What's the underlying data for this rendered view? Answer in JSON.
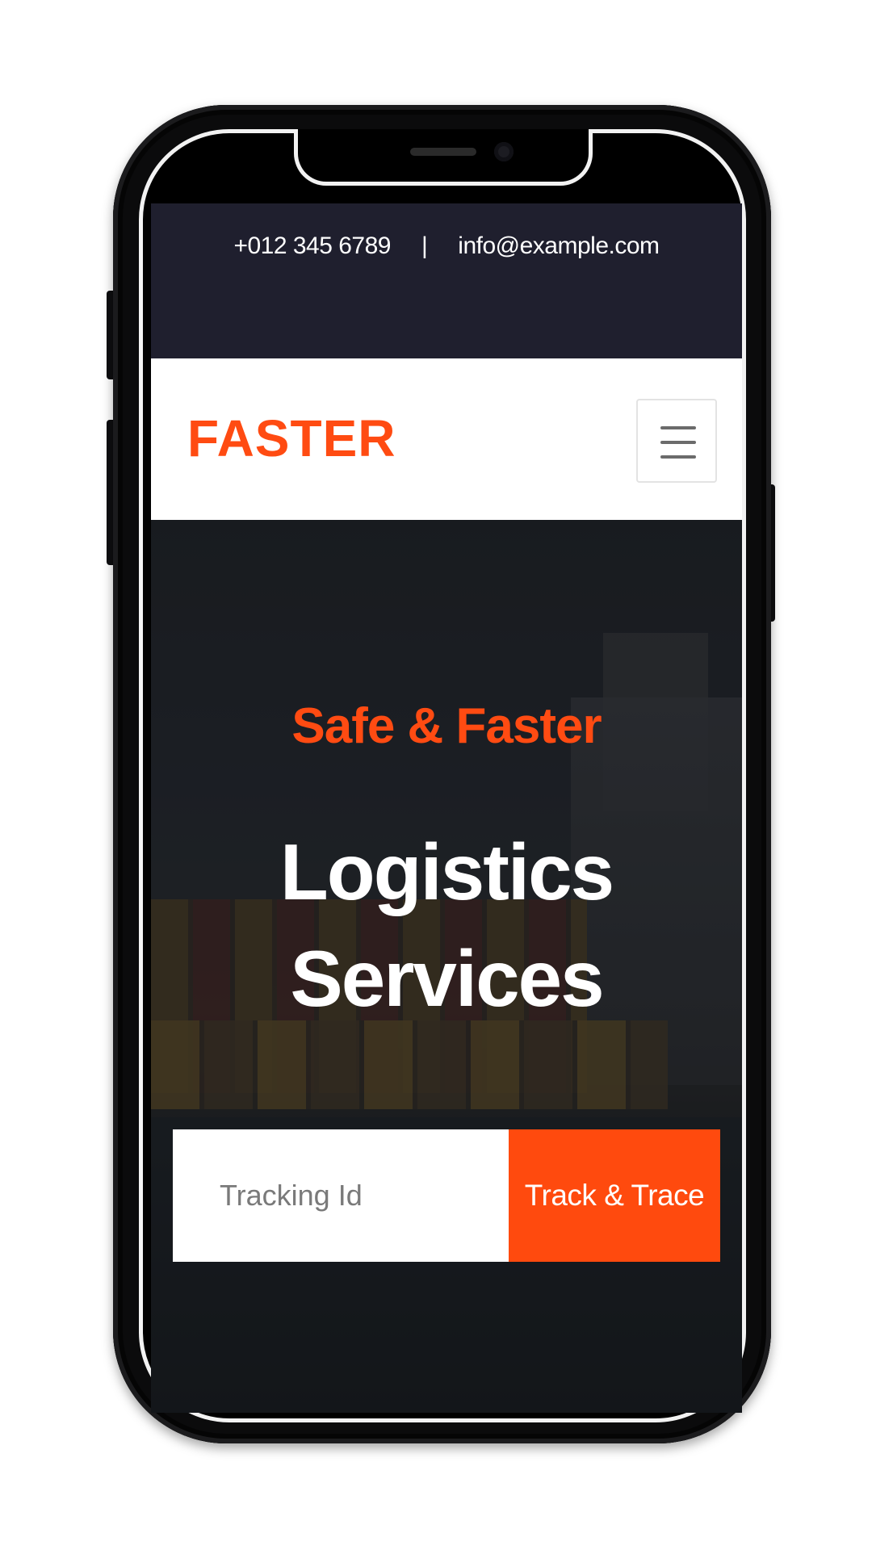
{
  "topbar": {
    "phone": "+012 345 6789",
    "separator": "|",
    "email": "info@example.com"
  },
  "navbar": {
    "brand": "FASTER",
    "menu_icon": "hamburger-menu-icon"
  },
  "hero": {
    "subtitle": "Safe & Faster",
    "title_line1": "Logistics",
    "title_line2": "Services"
  },
  "tracking": {
    "placeholder": "Tracking Id",
    "button_label": "Track & Trace"
  },
  "colors": {
    "accent": "#ff4b12",
    "topbar_bg": "#1f1f2e",
    "phone_frame": "#0b0b0c"
  }
}
